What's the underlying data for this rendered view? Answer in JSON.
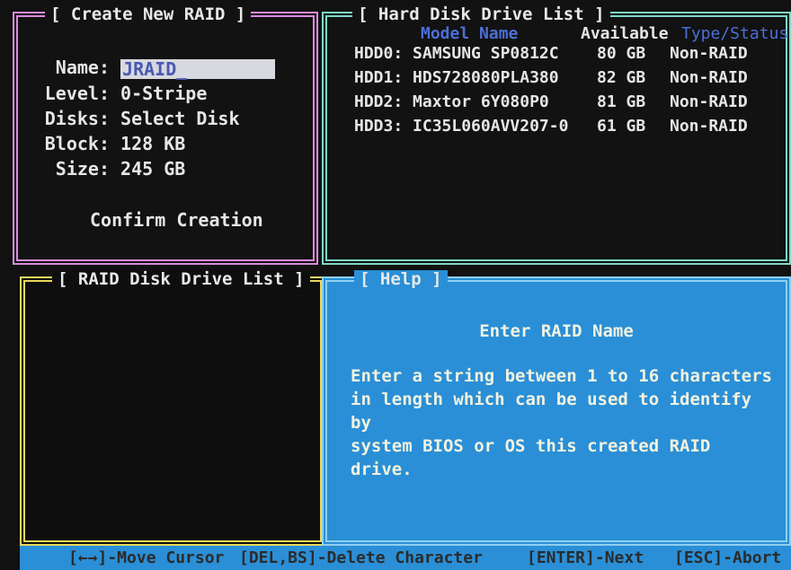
{
  "create_panel": {
    "title": "[ Create New RAID ]",
    "name_label": "Name:",
    "name_value": "JRAID_",
    "level_label": "Level:",
    "level_value": "0-Stripe",
    "disks_label": "Disks:",
    "disks_value": "Select Disk",
    "block_label": "Block:",
    "block_value": "128 KB",
    "size_label": "Size:",
    "size_value": "245 GB",
    "confirm_label": "Confirm Creation"
  },
  "hdd_panel": {
    "title": "[ Hard Disk Drive List ]",
    "columns": {
      "model": "Model Name",
      "available": "Available",
      "type": "Type/Status"
    },
    "rows": [
      {
        "id": "HDD0:",
        "model": "SAMSUNG SP0812C",
        "available": "80 GB",
        "type": "Non-RAID"
      },
      {
        "id": "HDD1:",
        "model": "HDS728080PLA380",
        "available": "82 GB",
        "type": "Non-RAID"
      },
      {
        "id": "HDD2:",
        "model": "Maxtor 6Y080P0",
        "available": "81 GB",
        "type": "Non-RAID"
      },
      {
        "id": "HDD3:",
        "model": "IC35L060AVV207-0",
        "available": "61 GB",
        "type": "Non-RAID"
      }
    ]
  },
  "raid_list_panel": {
    "title": "[ RAID Disk Drive List ]"
  },
  "help_panel": {
    "title": "[ Help ]",
    "heading": "Enter RAID Name",
    "line1": "Enter a string between  1 to 16 characters",
    "line2": "in length which can be used to identify by",
    "line3": "system BIOS or OS this created RAID drive."
  },
  "bottom_bar": {
    "move": "[←→]-Move Cursor",
    "delete": "[DEL,BS]-Delete Character",
    "next": "[ENTER]-Next",
    "abort": "[ESC]-Abort"
  },
  "colors": {
    "create_border": "#d98bd9",
    "hdd_border": "#7fd8c8",
    "raid_border": "#e8d85a",
    "help_bg": "#2a8fd6",
    "column_header_blue": "#4c6fd8",
    "column_header_white": "#e6e6e6"
  }
}
